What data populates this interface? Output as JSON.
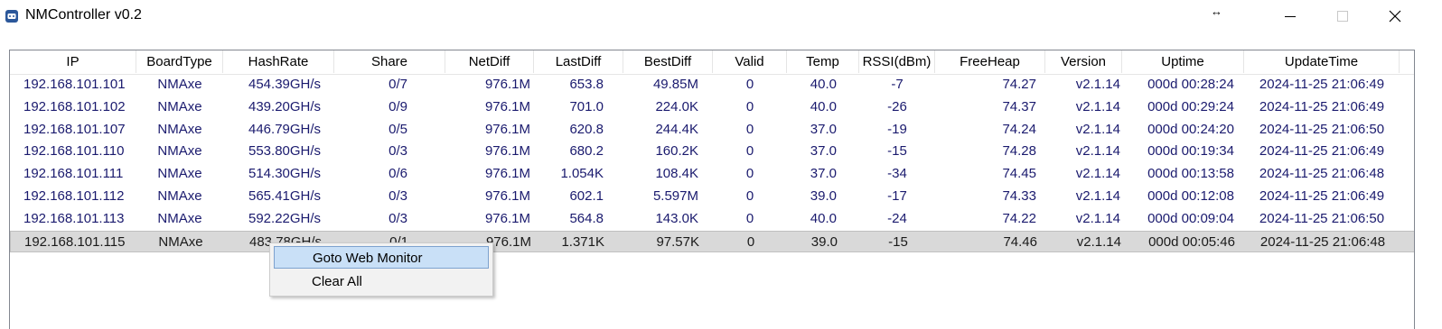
{
  "window": {
    "title": "NMController v0.2",
    "resize_cursor_glyph": "↔",
    "buttons": {
      "minimize": "minimize-icon",
      "maximize": "maximize-icon",
      "close": "close-icon"
    }
  },
  "table": {
    "columns": [
      "IP",
      "BoardType",
      "HashRate",
      "Share",
      "NetDiff",
      "LastDiff",
      "BestDiff",
      "Valid",
      "Temp",
      "RSSI(dBm)",
      "FreeHeap",
      "Version",
      "Uptime",
      "UpdateTime"
    ],
    "rows": [
      [
        "192.168.101.101",
        "NMAxe",
        "454.39GH/s",
        "0/7",
        "976.1M",
        "653.8",
        "49.85M",
        "0",
        "40.0",
        "-7",
        "74.27",
        "v2.1.14",
        "000d 00:28:24",
        "2024-11-25 21:06:49"
      ],
      [
        "192.168.101.102",
        "NMAxe",
        "439.20GH/s",
        "0/9",
        "976.1M",
        "701.0",
        "224.0K",
        "0",
        "40.0",
        "-26",
        "74.37",
        "v2.1.14",
        "000d 00:29:24",
        "2024-11-25 21:06:49"
      ],
      [
        "192.168.101.107",
        "NMAxe",
        "446.79GH/s",
        "0/5",
        "976.1M",
        "620.8",
        "244.4K",
        "0",
        "37.0",
        "-19",
        "74.24",
        "v2.1.14",
        "000d 00:24:20",
        "2024-11-25 21:06:50"
      ],
      [
        "192.168.101.110",
        "NMAxe",
        "553.80GH/s",
        "0/3",
        "976.1M",
        "680.2",
        "160.2K",
        "0",
        "37.0",
        "-15",
        "74.28",
        "v2.1.14",
        "000d 00:19:34",
        "2024-11-25 21:06:49"
      ],
      [
        "192.168.101.111",
        "NMAxe",
        "514.30GH/s",
        "0/6",
        "976.1M",
        "1.054K",
        "108.4K",
        "0",
        "37.0",
        "-34",
        "74.45",
        "v2.1.14",
        "000d 00:13:58",
        "2024-11-25 21:06:48"
      ],
      [
        "192.168.101.112",
        "NMAxe",
        "565.41GH/s",
        "0/3",
        "976.1M",
        "602.1",
        "5.597M",
        "0",
        "39.0",
        "-17",
        "74.33",
        "v2.1.14",
        "000d 00:12:08",
        "2024-11-25 21:06:49"
      ],
      [
        "192.168.101.113",
        "NMAxe",
        "592.22GH/s",
        "0/3",
        "976.1M",
        "564.8",
        "143.0K",
        "0",
        "40.0",
        "-24",
        "74.22",
        "v2.1.14",
        "000d 00:09:04",
        "2024-11-25 21:06:50"
      ],
      [
        "192.168.101.115",
        "NMAxe",
        "483.78GH/s",
        "0/1",
        "976.1M",
        "1.371K",
        "97.57K",
        "0",
        "39.0",
        "-15",
        "74.46",
        "v2.1.14",
        "000d 00:05:46",
        "2024-11-25 21:06:48"
      ]
    ],
    "selected_row": 7
  },
  "context_menu": {
    "items": [
      "Goto Web Monitor",
      "Clear All"
    ]
  }
}
